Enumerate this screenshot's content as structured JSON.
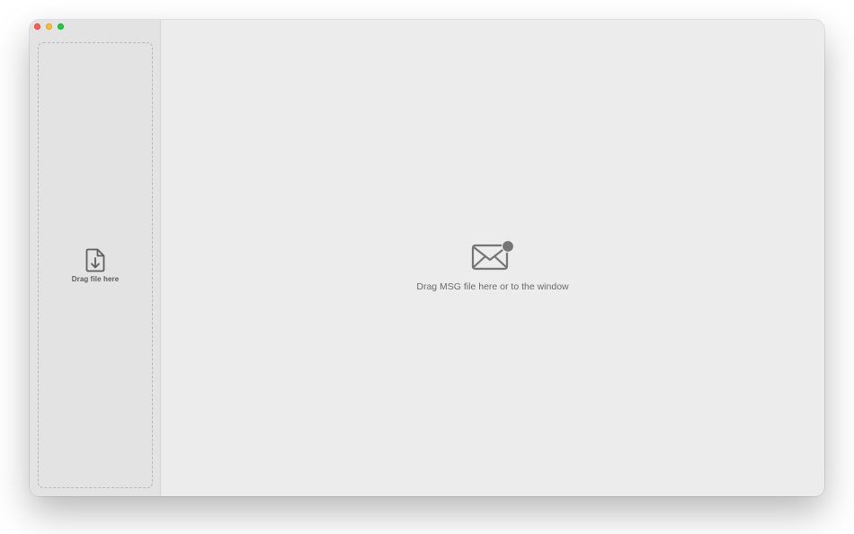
{
  "window": {
    "traffic_lights": {
      "close": "#fe5f57",
      "minimize": "#febc2e",
      "zoom": "#28c840"
    }
  },
  "sidebar": {
    "dropzone": {
      "icon": "file-download-icon",
      "label": "Drag file here"
    }
  },
  "main": {
    "empty_state": {
      "icon": "mail-badge-icon",
      "label": "Drag MSG file here or to the window"
    }
  }
}
